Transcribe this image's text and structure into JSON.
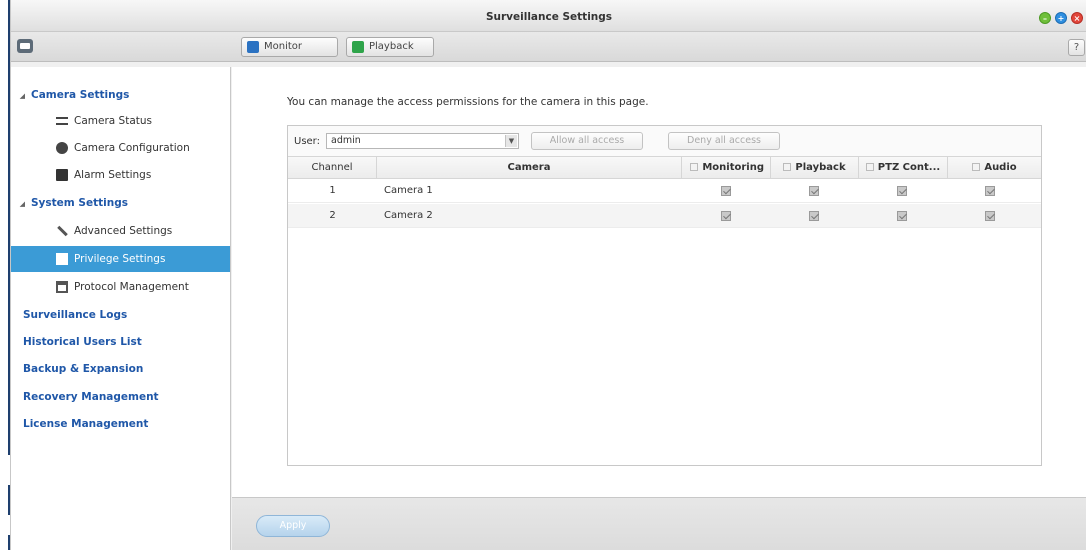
{
  "window": {
    "title": "Surveillance Settings",
    "help": "?"
  },
  "toolbar": {
    "monitor": "Monitor",
    "playback": "Playback"
  },
  "sidebar": {
    "camera_settings": "Camera Settings",
    "camera_status": "Camera Status",
    "camera_configuration": "Camera Configuration",
    "alarm_settings": "Alarm Settings",
    "system_settings": "System Settings",
    "advanced_settings": "Advanced Settings",
    "privilege_settings": "Privilege Settings",
    "protocol_management": "Protocol Management",
    "surveillance_logs": "Surveillance Logs",
    "historical_users_list": "Historical Users List",
    "backup_expansion": "Backup & Expansion",
    "recovery_management": "Recovery Management",
    "license_management": "License Management"
  },
  "main": {
    "intro": "You can manage the access permissions for the camera in this page.",
    "user_label": "User:",
    "user_value": "admin",
    "allow_all": "Allow all access",
    "deny_all": "Deny all access",
    "headers": {
      "channel": "Channel",
      "camera": "Camera",
      "monitoring": "Monitoring",
      "playback": "Playback",
      "ptz": "PTZ Cont...",
      "audio": "Audio"
    },
    "rows": [
      {
        "channel": "1",
        "camera": "Camera 1",
        "monitoring": true,
        "playback": true,
        "ptz": true,
        "audio": true
      },
      {
        "channel": "2",
        "camera": "Camera 2",
        "monitoring": true,
        "playback": true,
        "ptz": true,
        "audio": true
      }
    ]
  },
  "footer": {
    "apply": "Apply"
  },
  "colors": {
    "accent": "#3b9bd6",
    "nav_group": "#1f57a8"
  }
}
